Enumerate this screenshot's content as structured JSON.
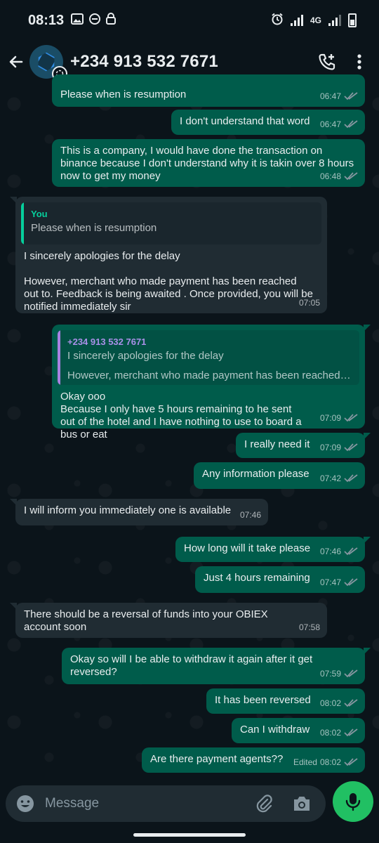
{
  "status_bar": {
    "time": "08:13",
    "network": "4G"
  },
  "header": {
    "contact_name": "+234 913 532 7671"
  },
  "messages": [
    {
      "id": "m1",
      "dir": "out",
      "text": "Please when is resumption",
      "time": "06:47"
    },
    {
      "id": "m2",
      "dir": "out",
      "text": "I don't understand that word",
      "time": "06:47"
    },
    {
      "id": "m3",
      "dir": "out",
      "text": "This is a company, I would have done the transaction on binance because I don't understand why it is takin over 8 hours now to get my money",
      "time": "06:48"
    },
    {
      "id": "m4",
      "dir": "in",
      "quote_author": "You",
      "quote_text": "Please when is resumption",
      "text_line1": "I sincerely apologies for the delay",
      "text_line2": "However, merchant who made payment has been reached out to. Feedback is being awaited . Once provided, you will be notified immediately sir",
      "time": "07:05"
    },
    {
      "id": "m5",
      "dir": "out",
      "quote_author": "+234 913 532 7671",
      "quote_text": "I sincerely apologies for the delay",
      "quote_text2": "However, merchant who made payment has been reached ou...",
      "text_line1": "Okay ooo",
      "text_line2": "Because I only have 5 hours remaining to he sent out of the hotel and I have nothing to use to board a bus or eat",
      "time": "07:09"
    },
    {
      "id": "m6",
      "dir": "out",
      "text": "I really need it",
      "time": "07:09"
    },
    {
      "id": "m7",
      "dir": "out",
      "text": "Any information please",
      "time": "07:42"
    },
    {
      "id": "m8",
      "dir": "in",
      "text": "I will inform you immediately one is available",
      "time": "07:46"
    },
    {
      "id": "m9",
      "dir": "out",
      "text": "How long will it take please",
      "time": "07:46"
    },
    {
      "id": "m10",
      "dir": "out",
      "text": "Just 4 hours remaining",
      "time": "07:47"
    },
    {
      "id": "m11",
      "dir": "in",
      "text": "There should be a reversal of funds into your OBIEX  account soon",
      "time": "07:58"
    },
    {
      "id": "m12",
      "dir": "out",
      "text": "Okay so will I be able to withdraw it again after it get reversed?",
      "time": "07:59"
    },
    {
      "id": "m13",
      "dir": "out",
      "text": "It has been reversed",
      "time": "08:02"
    },
    {
      "id": "m14",
      "dir": "out",
      "text": "Can I withdraw",
      "time": "08:02"
    },
    {
      "id": "m15",
      "dir": "out",
      "text": "Are there payment agents??",
      "edited_label": "Edited",
      "time": "08:02"
    }
  ],
  "composer": {
    "placeholder": "Message"
  },
  "colors": {
    "outgoing_bubble": "#005c4b",
    "incoming_bubble": "#202c33",
    "background": "#0b141a",
    "accent": "#21c063",
    "read_ticks": "#8696a0"
  },
  "icons": {
    "back": "arrow-left-icon",
    "add_call": "phone-plus-icon",
    "more": "more-vertical-icon",
    "emoji": "emoji-icon",
    "attach": "paperclip-icon",
    "camera": "camera-icon",
    "mic": "microphone-icon"
  }
}
